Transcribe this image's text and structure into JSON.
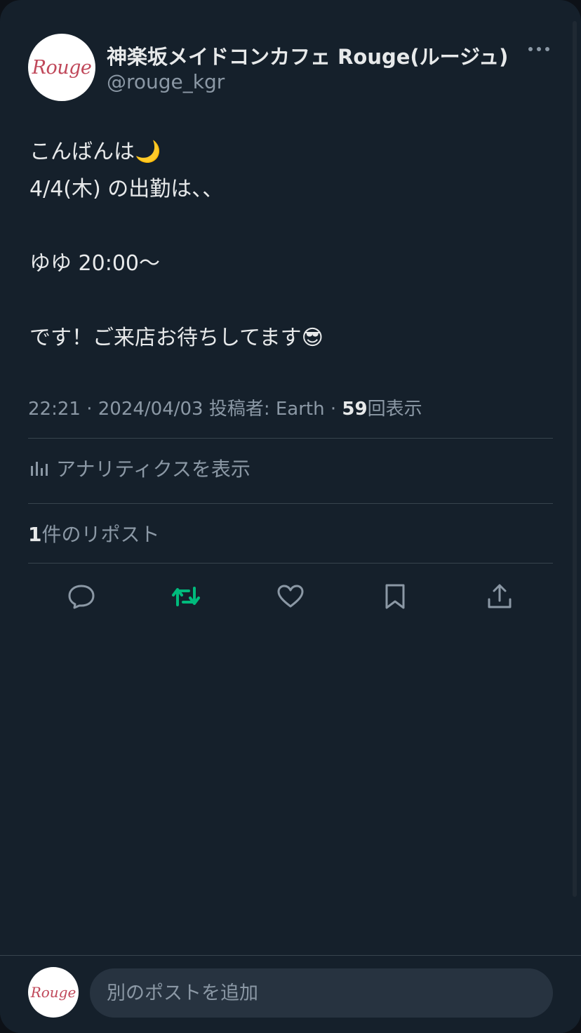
{
  "colors": {
    "background": "#15202b",
    "text_primary": "#e7e9ea",
    "text_secondary": "#8b98a5",
    "divider": "#38444d",
    "repost_active": "#00ba7c",
    "avatar_brand": "#c0485a"
  },
  "author": {
    "display_name": "神楽坂メイドコンカフェ Rouge(ルージュ)",
    "handle": "@rouge_kgr",
    "avatar_text": "Rouge",
    "avatar_icon": "rouge-logo"
  },
  "post": {
    "lines": [
      "こんばんは🌙",
      "4/4(木) の出勤は、、",
      "",
      "ゆゆ 20:00～",
      "",
      "です！ご来店お待ちしてます😎"
    ]
  },
  "meta": {
    "time": "22:21",
    "date": "2024/04/03",
    "source": "投稿者: Earth",
    "separator": "·",
    "views_count": "59",
    "views_label": "回表示"
  },
  "analytics": {
    "label": "アナリティクスを表示",
    "icon": "bar-chart-icon"
  },
  "reposts": {
    "count": "1",
    "label": "件のリポスト"
  },
  "actions": [
    {
      "name": "reply",
      "icon": "reply-icon"
    },
    {
      "name": "repost",
      "icon": "repost-icon"
    },
    {
      "name": "like",
      "icon": "heart-icon"
    },
    {
      "name": "bookmark",
      "icon": "bookmark-icon"
    },
    {
      "name": "share",
      "icon": "share-icon"
    }
  ],
  "reply_bar": {
    "avatar_text": "Rouge",
    "placeholder": "別のポストを追加"
  }
}
